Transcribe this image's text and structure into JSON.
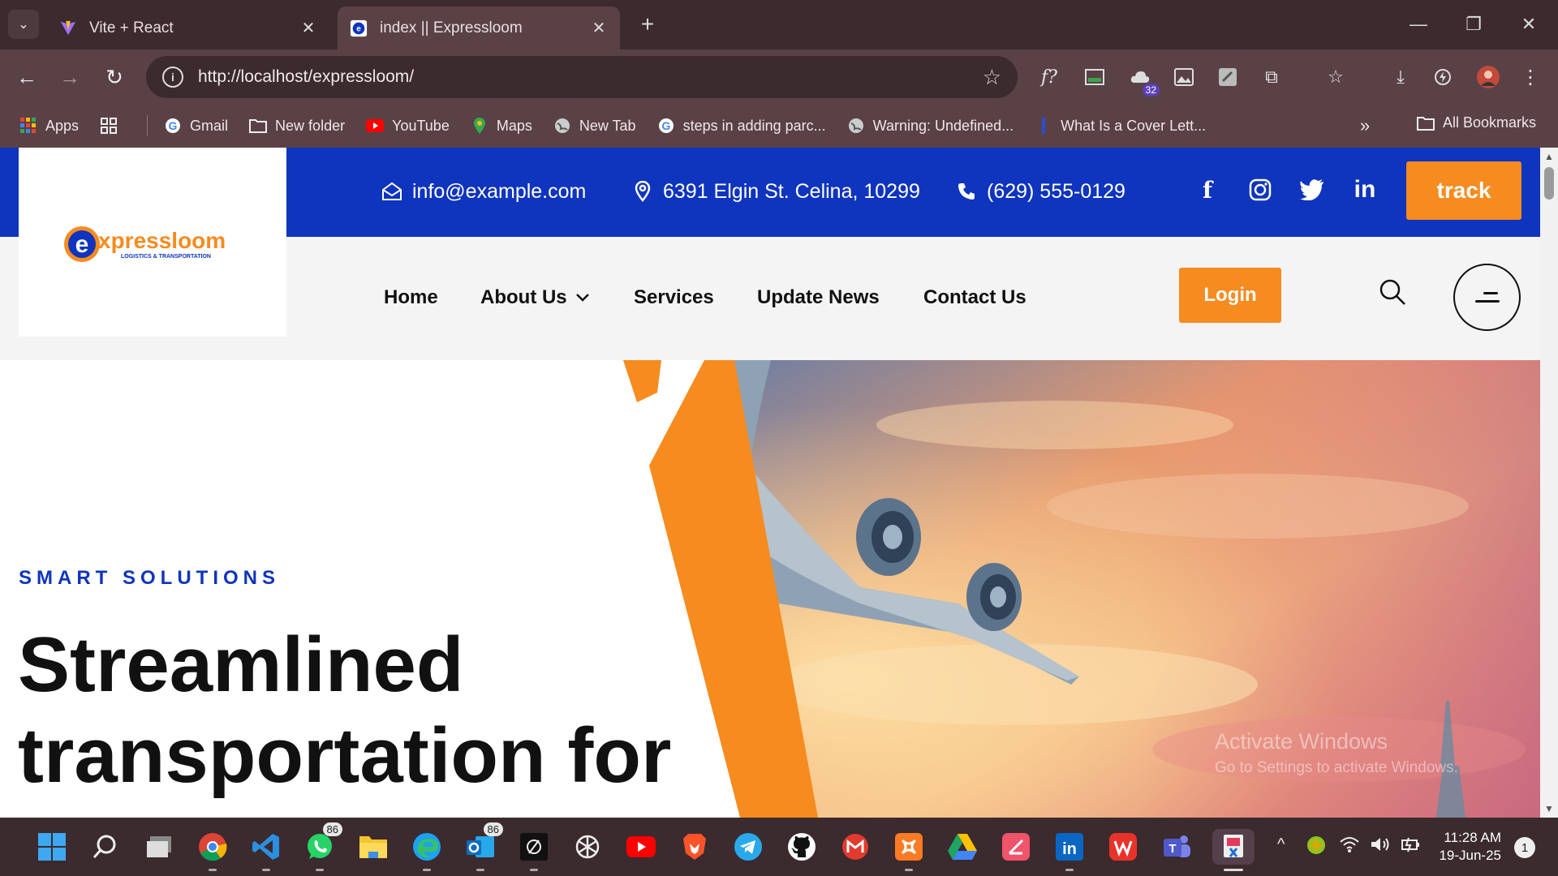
{
  "browser": {
    "tabs": [
      {
        "title": "Vite + React",
        "active": false
      },
      {
        "title": "index || Expressloom",
        "active": true
      }
    ],
    "url": "http://localhost/expressloom/",
    "extension_badge": "32",
    "bookmarks": [
      {
        "label": "Apps",
        "icon": "apps-grid-icon"
      },
      {
        "label": "Gmail",
        "icon": "google-icon"
      },
      {
        "label": "New folder",
        "icon": "folder-icon"
      },
      {
        "label": "YouTube",
        "icon": "youtube-icon"
      },
      {
        "label": "Maps",
        "icon": "maps-icon"
      },
      {
        "label": "New Tab",
        "icon": "globe-icon"
      },
      {
        "label": "steps in adding parc...",
        "icon": "google-icon"
      },
      {
        "label": "Warning: Undefined...",
        "icon": "globe-icon"
      },
      {
        "label": "What Is a Cover Lett...",
        "icon": "page-icon"
      }
    ],
    "all_bookmarks": "All Bookmarks"
  },
  "site": {
    "brand": {
      "name_first": "e",
      "name_rest": "xpressloom",
      "tagline": "LOGISTICS & TRANSPORTATION",
      "blue": "#0f34be",
      "orange": "#f68b1f"
    },
    "topbar": {
      "email": "info@example.com",
      "address": "6391 Elgin St. Celina, 10299",
      "phone": "(629) 555-0129",
      "track_label": "track"
    },
    "nav": {
      "links": [
        "Home",
        "About Us",
        "Services",
        "Update News",
        "Contact Us"
      ],
      "login_label": "Login"
    },
    "hero": {
      "eyebrow": "SMART SOLUTIONS",
      "headline_line1": "Streamlined",
      "headline_line2": "transportation for"
    }
  },
  "watermark": {
    "line1": "Activate Windows",
    "line2": "Go to Settings to activate Windows."
  },
  "taskbar": {
    "apps": [
      {
        "name": "start",
        "badge": ""
      },
      {
        "name": "search",
        "badge": ""
      },
      {
        "name": "task-view",
        "badge": ""
      },
      {
        "name": "chrome",
        "badge": ""
      },
      {
        "name": "vscode",
        "badge": ""
      },
      {
        "name": "whatsapp",
        "badge": "86"
      },
      {
        "name": "file-explorer",
        "badge": ""
      },
      {
        "name": "edge",
        "badge": ""
      },
      {
        "name": "outlook",
        "badge": "86"
      },
      {
        "name": "cursor",
        "badge": ""
      },
      {
        "name": "chatgpt",
        "badge": ""
      },
      {
        "name": "youtube",
        "badge": ""
      },
      {
        "name": "brave",
        "badge": ""
      },
      {
        "name": "telegram",
        "badge": ""
      },
      {
        "name": "github",
        "badge": ""
      },
      {
        "name": "gmail",
        "badge": ""
      },
      {
        "name": "xampp",
        "badge": ""
      },
      {
        "name": "google-drive",
        "badge": ""
      },
      {
        "name": "laravel",
        "badge": ""
      },
      {
        "name": "linkedin",
        "badge": ""
      },
      {
        "name": "wps-office",
        "badge": ""
      },
      {
        "name": "teams",
        "badge": ""
      },
      {
        "name": "snipping-tool",
        "badge": ""
      }
    ],
    "time": "11:28 AM",
    "date": "19-Jun-25",
    "notifications": "1"
  }
}
